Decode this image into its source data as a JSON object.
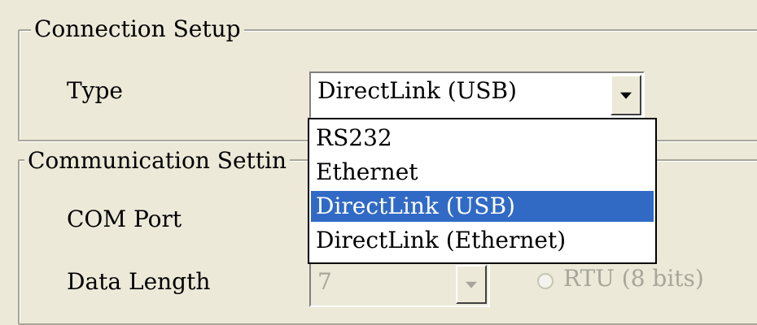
{
  "connection_setup": {
    "legend": "Connection Setup",
    "type_label": "Type",
    "type_value": "DirectLink (USB)"
  },
  "type_dropdown": {
    "options": [
      "RS232",
      "Ethernet",
      "DirectLink (USB)",
      "DirectLink (Ethernet)"
    ],
    "selected_index": 2
  },
  "communication_settings": {
    "legend": "Communication Settin",
    "com_port_label": "COM Port",
    "data_length_label": "Data Length",
    "data_length_value": "7",
    "rtu_label": "RTU (8 bits)"
  },
  "colors": {
    "window_bg": "#ece9d8",
    "selection_bg": "#316ac5",
    "disabled_text": "#a7a69a"
  }
}
